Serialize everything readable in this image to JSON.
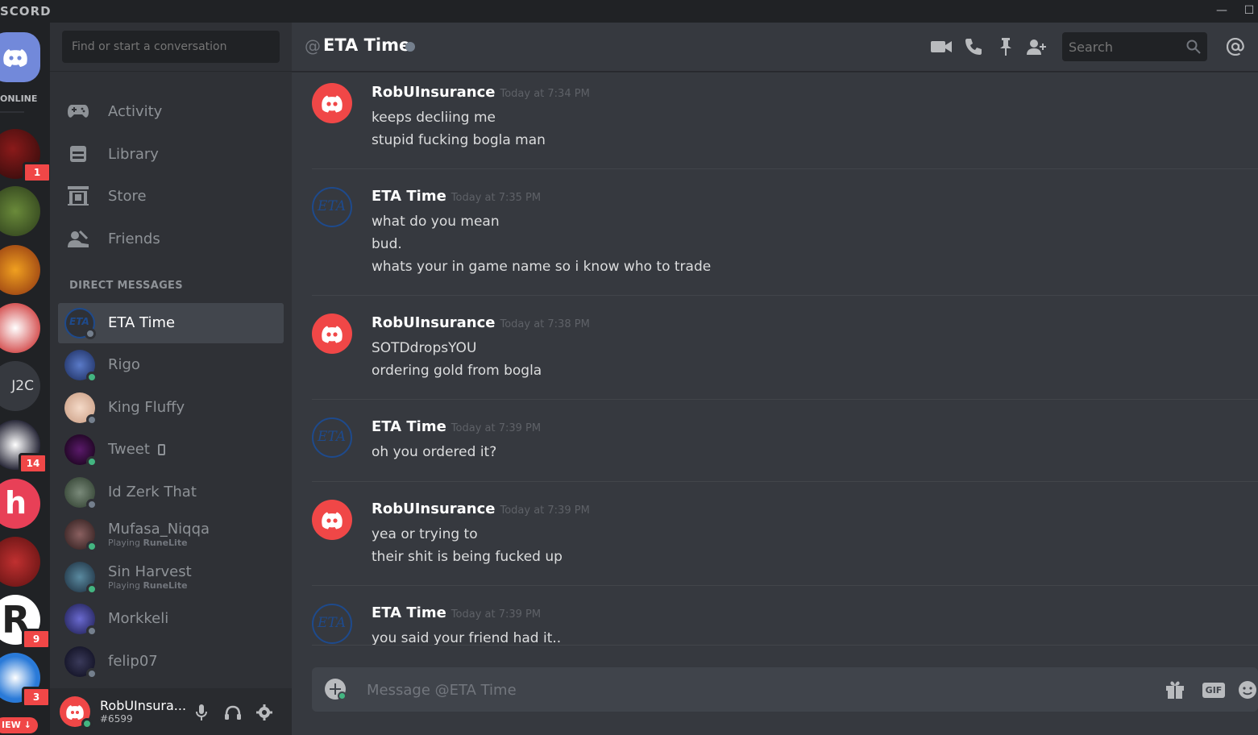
{
  "app": {
    "brand": "SCORD",
    "minimize": "—",
    "maximize": "☐"
  },
  "guilds": {
    "online_label": "ONLINE",
    "j2c_label": "J2C",
    "badges": [
      "1",
      "14",
      "9",
      "3"
    ],
    "new_label": "IEW ↓"
  },
  "dm_sidebar": {
    "search_placeholder": "Find or start a conversation",
    "nav": [
      {
        "label": "Activity",
        "icon": "gamepad-icon"
      },
      {
        "label": "Library",
        "icon": "library-icon"
      },
      {
        "label": "Store",
        "icon": "store-icon"
      },
      {
        "label": "Friends",
        "icon": "friends-icon"
      }
    ],
    "dm_header": "DIRECT MESSAGES",
    "dms": [
      {
        "name": "ETA Time",
        "status": "offline",
        "sub": "",
        "color": "#1e4a8c"
      },
      {
        "name": "Rigo",
        "status": "online",
        "sub": "",
        "color": "#2a3f7a"
      },
      {
        "name": "King Fluffy",
        "status": "offline",
        "sub": "",
        "color": "#e8c8b0"
      },
      {
        "name": "Tweet",
        "status": "online",
        "sub": "",
        "color": "#2a0f3a"
      },
      {
        "name": "Id Zerk That",
        "status": "offline",
        "sub": "",
        "color": "#4a5a4a"
      },
      {
        "name": "Mufasa_Niqqa",
        "status": "online",
        "sub": "Playing ",
        "sub_game": "RuneLite",
        "color": "#5a4040"
      },
      {
        "name": "Sin Harvest",
        "status": "online",
        "sub": "Playing ",
        "sub_game": "RuneLite",
        "color": "#3a5a6a"
      },
      {
        "name": "Morkkeli",
        "status": "offline",
        "sub": "",
        "color": "#3a3a8a"
      },
      {
        "name": "felip07",
        "status": "offline",
        "sub": "",
        "color": "#1a1a2a"
      }
    ],
    "user": {
      "name": "RobUInsura...",
      "tag": "#6599"
    }
  },
  "chat": {
    "at_symbol": "@",
    "title": "ETA Time",
    "search_placeholder": "Search",
    "composer_placeholder": "Message @ETA Time",
    "gif_label": "GIF",
    "messages": [
      {
        "author": "RobUInsurance",
        "time": "Today at 7:34 PM",
        "avatar": "discord",
        "lines": [
          "keeps decliing me",
          "stupid fucking bogla man"
        ]
      },
      {
        "author": "ETA Time",
        "time": "Today at 7:35 PM",
        "avatar": "eta",
        "lines": [
          "what do you mean",
          "bud.",
          "whats your in game name so i know who to trade"
        ]
      },
      {
        "author": "RobUInsurance",
        "time": "Today at 7:38 PM",
        "avatar": "discord",
        "lines": [
          "SOTDdropsYOU",
          "ordering gold from bogla"
        ]
      },
      {
        "author": "ETA Time",
        "time": "Today at 7:39 PM",
        "avatar": "eta",
        "lines": [
          "oh you ordered it?"
        ]
      },
      {
        "author": "RobUInsurance",
        "time": "Today at 7:39 PM",
        "avatar": "discord",
        "lines": [
          "yea or trying to",
          "their shit is being fucked up"
        ]
      },
      {
        "author": "ETA Time",
        "time": "Today at 7:39 PM",
        "avatar": "eta",
        "lines": [
          "you said your friend had it.."
        ]
      }
    ]
  },
  "colors": {
    "accent": "#7289da",
    "discord_red": "#f04747",
    "online": "#43b581",
    "offline": "#747f8d"
  }
}
